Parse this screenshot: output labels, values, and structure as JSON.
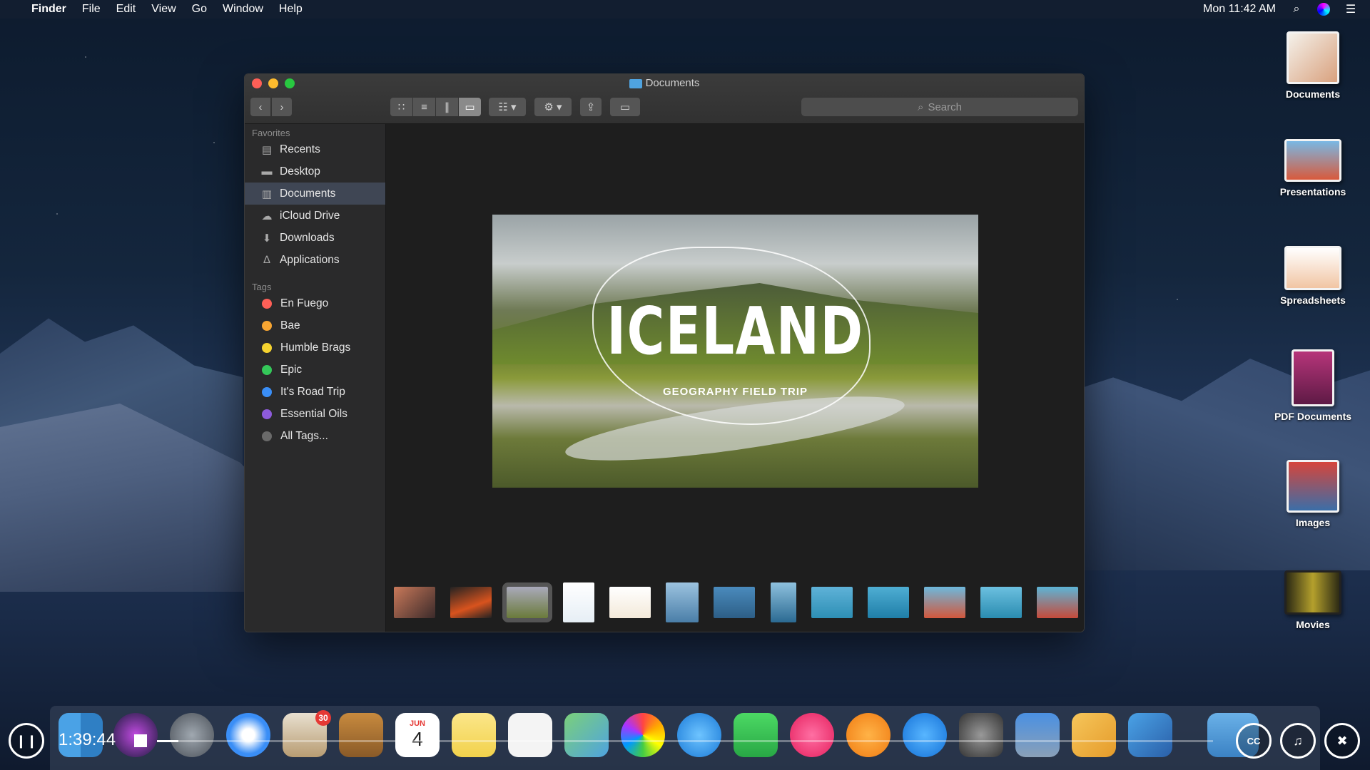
{
  "menubar": {
    "app": "Finder",
    "items": [
      "File",
      "Edit",
      "View",
      "Go",
      "Window",
      "Help"
    ],
    "clock": "Mon 11:42 AM"
  },
  "window": {
    "title": "Documents",
    "search_placeholder": "Search"
  },
  "sidebar": {
    "favorites_header": "Favorites",
    "favorites": [
      "Recents",
      "Desktop",
      "Documents",
      "iCloud Drive",
      "Downloads",
      "Applications"
    ],
    "selected": "Documents",
    "tags_header": "Tags",
    "tags": [
      {
        "label": "En Fuego",
        "color": "#fe5f57"
      },
      {
        "label": "Bae",
        "color": "#f7a532"
      },
      {
        "label": "Humble Brags",
        "color": "#f5d22f"
      },
      {
        "label": "Epic",
        "color": "#34c759"
      },
      {
        "label": "It's Road Trip",
        "color": "#3a8ef6"
      },
      {
        "label": "Essential Oils",
        "color": "#8e5bdb"
      },
      {
        "label": "All Tags...",
        "color": "#6a6a6a"
      }
    ]
  },
  "preview": {
    "title": "ICELAND",
    "subtitle": "GEOGRAPHY FIELD TRIP"
  },
  "stacks": [
    "Documents",
    "Presentations",
    "Spreadsheets",
    "PDF Documents",
    "Images",
    "Movies"
  ],
  "dock": {
    "mail_badge": "30",
    "calendar_month": "JUN",
    "calendar_day": "4"
  },
  "player": {
    "time": "1:39:44",
    "progress": 0.02
  }
}
